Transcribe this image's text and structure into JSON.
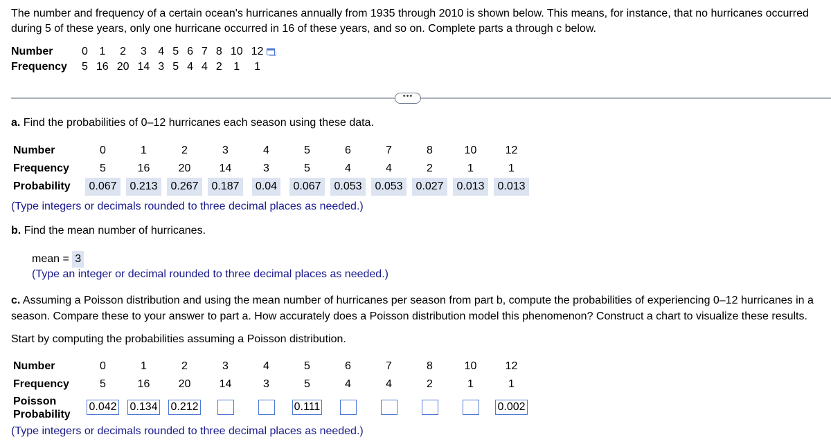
{
  "intro": "The number and frequency of a certain ocean's hurricanes annually from 1935 through 2010 is shown below. This means, for instance, that no hurricanes occurred during 5 of these years, only one hurricane occurred in 16 of these years, and so on. Complete parts a through c below.",
  "given_table": {
    "number_label": "Number",
    "frequency_label": "Frequency",
    "numbers": [
      "0",
      "1",
      "2",
      "3",
      "4",
      "5",
      "6",
      "7",
      "8",
      "10",
      "12"
    ],
    "frequencies": [
      "5",
      "16",
      "20",
      "14",
      "3",
      "5",
      "4",
      "4",
      "2",
      "1",
      "1"
    ]
  },
  "more_button": "•••",
  "part_a": {
    "prefix": "a.",
    "question": " Find the probabilities of 0–12 hurricanes each season using these data.",
    "number_label": "Number",
    "frequency_label": "Frequency",
    "probability_label": "Probability",
    "numbers": [
      "0",
      "1",
      "2",
      "3",
      "4",
      "5",
      "6",
      "7",
      "8",
      "10",
      "12"
    ],
    "frequencies": [
      "5",
      "16",
      "20",
      "14",
      "3",
      "5",
      "4",
      "4",
      "2",
      "1",
      "1"
    ],
    "probabilities": [
      "0.067",
      "0.213",
      "0.267",
      "0.187",
      "0.04",
      "0.067",
      "0.053",
      "0.053",
      "0.027",
      "0.013",
      "0.013"
    ],
    "hint": "(Type integers or decimals rounded to three decimal places as needed.)"
  },
  "part_b": {
    "prefix": "b.",
    "question": " Find the mean number of hurricanes.",
    "mean_label": "mean = ",
    "mean_value": "3",
    "hint": "(Type an integer or decimal rounded to three decimal places as needed.)"
  },
  "part_c": {
    "prefix": "c.",
    "question": " Assuming a Poisson distribution and using the mean number of hurricanes per season from part b, compute the probabilities of experiencing 0–12 hurricanes in a season. Compare these to your answer to part a. How accurately does a Poisson distribution model this phenomenon? Construct a chart to visualize these results.",
    "instruction": "Start by computing the probabilities assuming a Poisson distribution.",
    "number_label": "Number",
    "frequency_label": "Frequency",
    "poisson_label_1": "Poisson",
    "poisson_label_2": "Probability",
    "numbers": [
      "0",
      "1",
      "2",
      "3",
      "4",
      "5",
      "6",
      "7",
      "8",
      "10",
      "12"
    ],
    "frequencies": [
      "5",
      "16",
      "20",
      "14",
      "3",
      "5",
      "4",
      "4",
      "2",
      "1",
      "1"
    ],
    "poisson_inputs": [
      "0.042",
      "0.134",
      "0.212",
      "",
      "",
      "0.111",
      "",
      "",
      "",
      "",
      "0.002"
    ],
    "hint": "(Type integers or decimals rounded to three decimal places as needed.)"
  }
}
